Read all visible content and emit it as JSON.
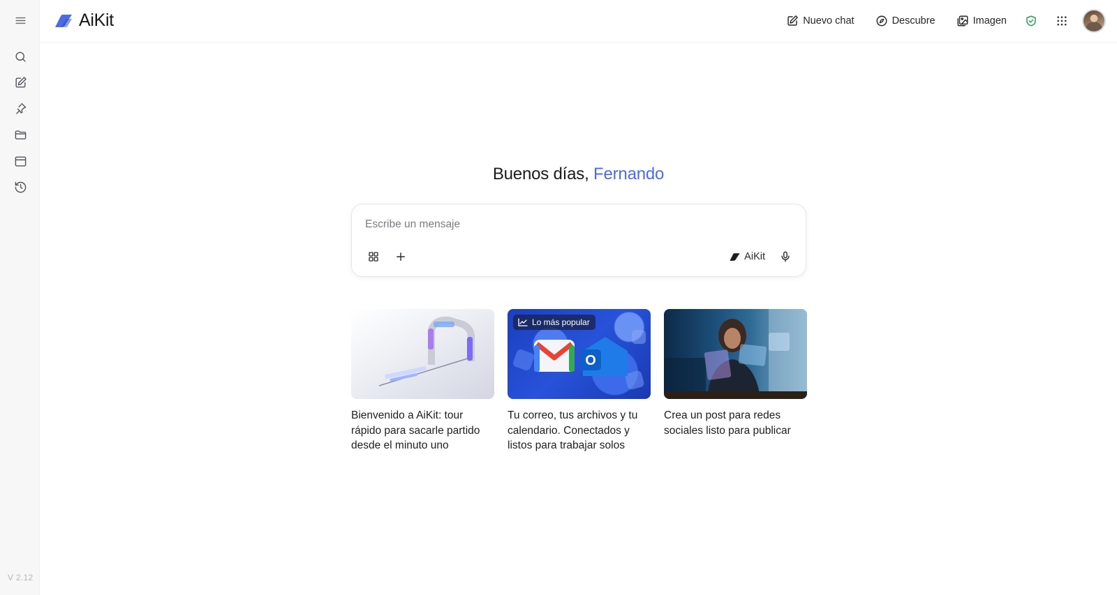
{
  "app": {
    "name": "AiKit",
    "version": "V 2.12"
  },
  "header": {
    "new_chat": "Nuevo chat",
    "discover": "Descubre",
    "image": "Imagen"
  },
  "greeting": {
    "prefix": "Buenos días,",
    "name": "Fernando"
  },
  "composer": {
    "placeholder": "Escribe un mensaje",
    "model_label": "AiKit"
  },
  "cards": [
    {
      "caption": "Bienvenido a AiKit: tour rápido para sacarle partido desde el minuto uno"
    },
    {
      "caption": "Tu correo, tus archivos y tu calendario. Conectados y listos para trabajar solos",
      "badge": "Lo más popular"
    },
    {
      "caption": "Crea un post para redes sociales listo para publicar"
    }
  ],
  "colors": {
    "accent": "#4a6de5",
    "shield": "#22a05a"
  }
}
